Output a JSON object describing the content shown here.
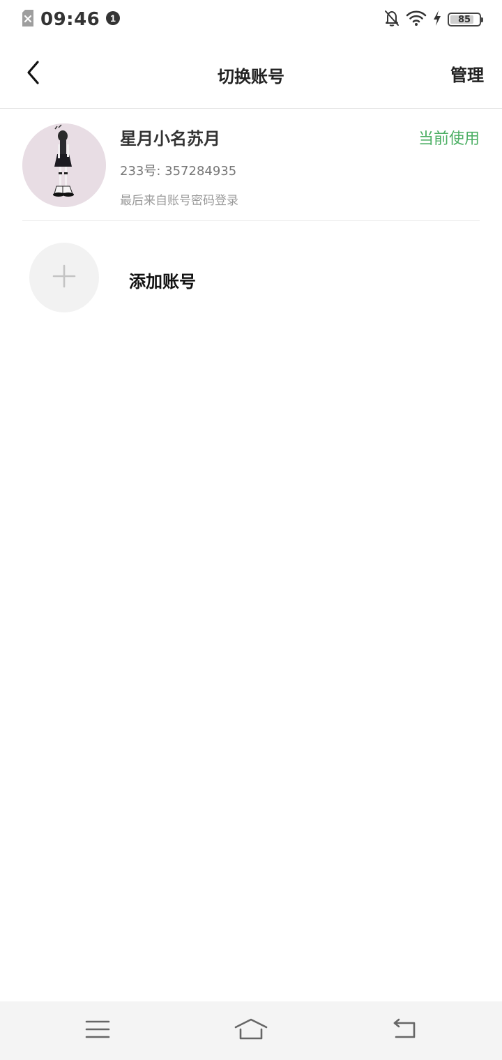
{
  "status_bar": {
    "time": "09:46",
    "notification_badge": "1",
    "battery_level": 85,
    "battery_text": "85",
    "icons": [
      "sim-error-icon",
      "notification-count-icon",
      "bell-off-icon",
      "wifi-icon",
      "charging-icon",
      "battery-icon"
    ]
  },
  "header": {
    "title": "切换账号",
    "manage_label": "管理",
    "back_icon": "chevron-left-icon"
  },
  "accounts": [
    {
      "name": "星月小名苏月",
      "id_text": "233号: 357284935",
      "login_text": "最后来自账号密码登录",
      "status": "当前使用"
    }
  ],
  "add_account": {
    "label": "添加账号",
    "icon": "plus-icon"
  },
  "nav_bar": {
    "icons": [
      "menu-icon",
      "home-icon",
      "back-icon"
    ]
  },
  "colors": {
    "accent": "#4caf64",
    "avatar_bg": "#e8dde4",
    "nav_bg": "#f4f4f4"
  }
}
